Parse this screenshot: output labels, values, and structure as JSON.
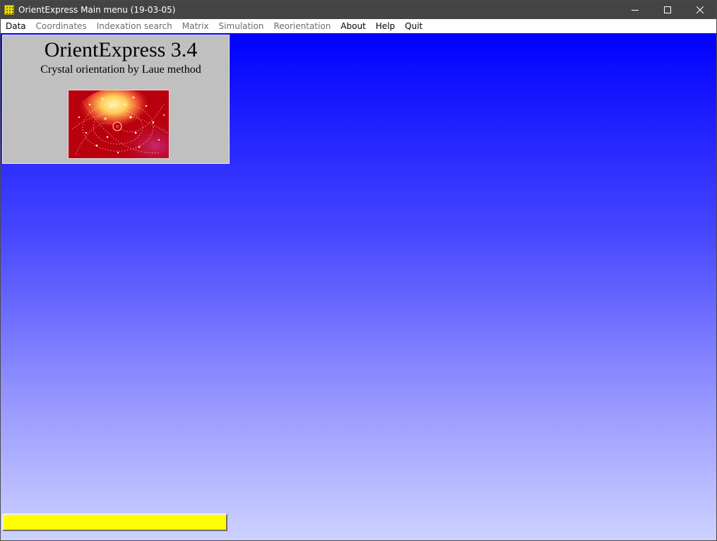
{
  "window": {
    "title": "OrientExpress Main menu (19-03-05)",
    "controls": [
      "minimize",
      "maximize",
      "close"
    ]
  },
  "menu": {
    "items": [
      {
        "label": "Data",
        "enabled": true
      },
      {
        "label": "Coordinates",
        "enabled": false
      },
      {
        "label": "Indexation search",
        "enabled": false
      },
      {
        "label": "Matrix",
        "enabled": false
      },
      {
        "label": "Simulation",
        "enabled": false
      },
      {
        "label": "Reorientation",
        "enabled": false
      },
      {
        "label": "About",
        "enabled": true
      },
      {
        "label": "Help",
        "enabled": true
      },
      {
        "label": "Quit",
        "enabled": true
      }
    ]
  },
  "splash": {
    "title": "OrientExpress 3.4",
    "subtitle": "Crystal orientation by Laue method",
    "image_icon": "laue-diffraction-pattern"
  },
  "colors": {
    "titlebar": "#444444",
    "client_top": "#0000ff",
    "client_bottom": "#cdd2ff",
    "splash_bg": "#c0c0c0",
    "status_bar": "#ffff00",
    "laue_bg": "#b8000e"
  }
}
